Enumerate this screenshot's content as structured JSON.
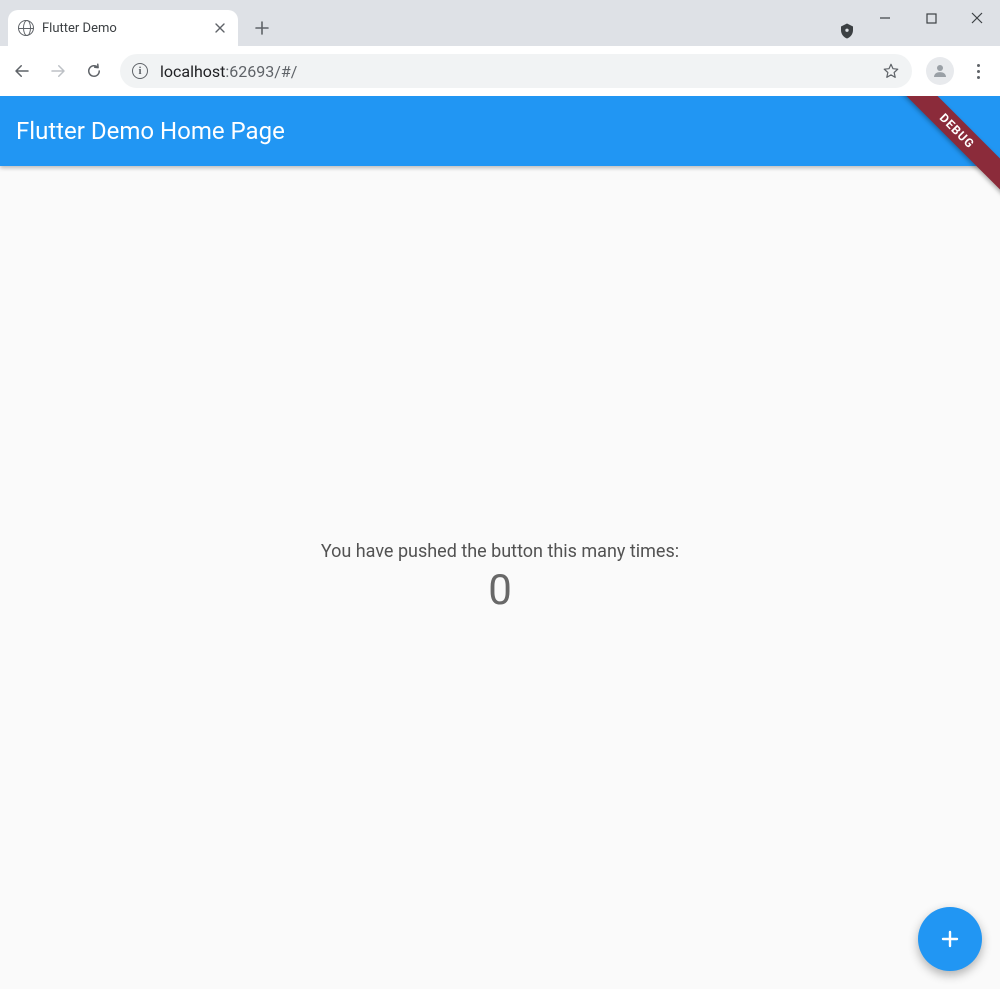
{
  "browser": {
    "tab_title": "Flutter Demo",
    "url_host": "localhost",
    "url_port": ":62693",
    "url_path": "/#/"
  },
  "app": {
    "appbar_title": "Flutter Demo Home Page",
    "debug_label": "DEBUG",
    "body_label": "You have pushed the button this many times:",
    "counter_value": "0",
    "fab_icon_name": "add-icon"
  }
}
